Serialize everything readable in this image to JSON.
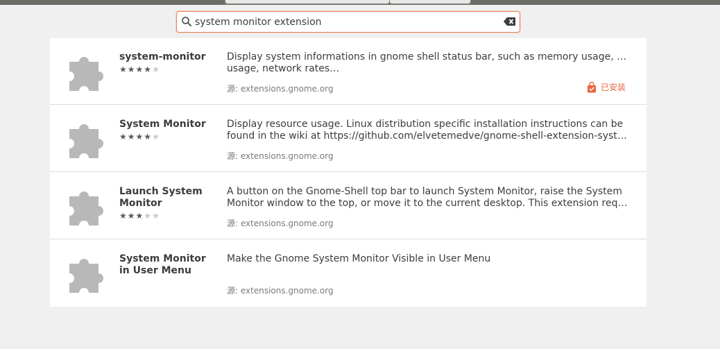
{
  "search": {
    "query": "system monitor extension",
    "icon": "search-icon",
    "clear_icon": "clear-icon"
  },
  "colors": {
    "accent": "#e8643c",
    "search_border": "#e9825a",
    "puzzle_gray": "#b8b8b8",
    "background": "#f0f0f0"
  },
  "results": [
    {
      "name": "system-monitor",
      "rating_stars": 4,
      "rating_max": 5,
      "desc_line1": "Display system informations in gnome shell status bar, such as memory usage, cpu",
      "desc_line2": "usage, network rates…",
      "source": "源: extensions.gnome.org",
      "status": "已安装",
      "icon": "puzzle-piece-icon"
    },
    {
      "name": "System Monitor",
      "rating_stars": 4,
      "rating_max": 5,
      "desc_line1": "Display resource usage.  Linux distribution specific installation instructions can be",
      "desc_line2": "found in the wiki at https://github.com/elvetemedve/gnome-shell-extension-system…",
      "source": "源: extensions.gnome.org",
      "status": "",
      "icon": "puzzle-piece-icon"
    },
    {
      "name": "Launch System Monitor",
      "rating_stars": 3,
      "rating_max": 5,
      "desc_line1": "A button on the Gnome-Shell top bar to launch System Monitor, raise the System",
      "desc_line2": "Monitor window to the top, or move it to the current desktop. This extension requir…",
      "source": "源: extensions.gnome.org",
      "status": "",
      "icon": "puzzle-piece-icon"
    },
    {
      "name": "System Monitor in User Menu",
      "rating_stars": 0,
      "rating_max": 0,
      "desc_line1": "Make the Gnome System Monitor Visible in User Menu",
      "desc_line2": "",
      "source": "源: extensions.gnome.org",
      "status": "",
      "icon": "puzzle-piece-icon"
    }
  ]
}
